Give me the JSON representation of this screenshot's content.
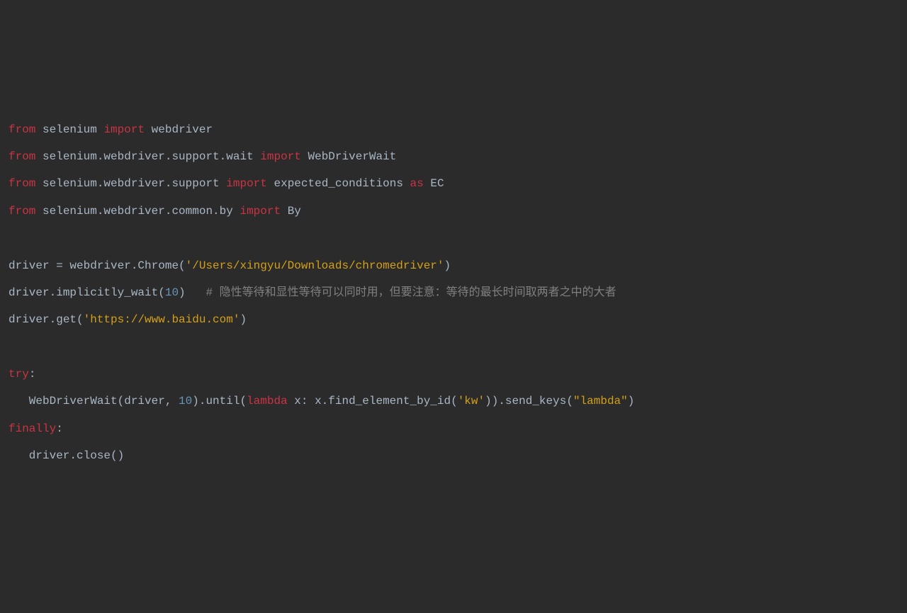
{
  "lines": {
    "l1": {
      "from": "from",
      "mod1": "selenium",
      "import": "import",
      "name1": "webdriver"
    },
    "l2": {
      "from": "from",
      "mod1": "selenium.webdriver.support.wait",
      "import": "import",
      "name1": "WebDriverWait"
    },
    "l3": {
      "from": "from",
      "mod1": "selenium.webdriver.support",
      "import": "import",
      "name1": "expected_conditions",
      "as": "as",
      "alias": "EC"
    },
    "l4": {
      "from": "from",
      "mod1": "selenium.webdriver.common.by",
      "import": "import",
      "name1": "By"
    },
    "l6": {
      "lhs": "driver = webdriver.Chrome(",
      "str": "'/Users/xingyu/Downloads/chromedriver'",
      "rparen": ")"
    },
    "l7": {
      "call": "driver.implicitly_wait(",
      "num": "10",
      "rparen": ")   ",
      "cmt": "# 隐性等待和显性等待可以同时用，但要注意：等待的最长时间取两者之中的大者"
    },
    "l8": {
      "call": "driver.get(",
      "str": "'https://www.baidu.com'",
      "rparen": ")"
    },
    "l10": {
      "try": "try",
      "colon": ":"
    },
    "l11": {
      "p1": "WebDriverWait(driver, ",
      "num": "10",
      "p2": ").until(",
      "lambda": "lambda",
      "p3": " x: x.find_element_by_id(",
      "str1": "'kw'",
      "p4": ")).send_keys(",
      "str2": "\"lambda\"",
      "p5": ")"
    },
    "l12": {
      "finally": "finally",
      "colon": ":"
    },
    "l13": {
      "call": "driver.close()"
    }
  }
}
